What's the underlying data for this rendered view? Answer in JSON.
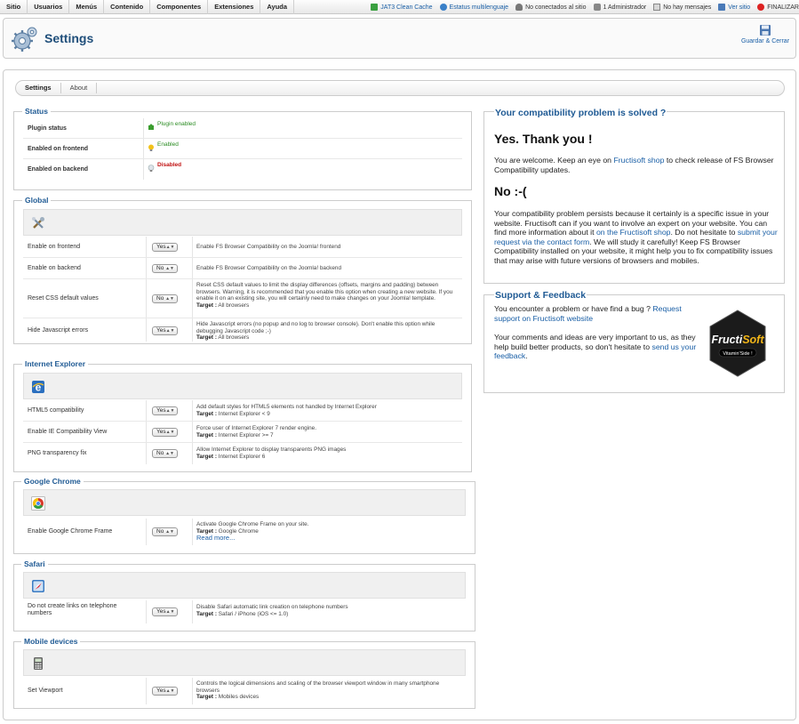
{
  "topbar": {
    "menu": [
      "Sitio",
      "Usuarios",
      "Menús",
      "Contenido",
      "Componentes",
      "Extensiones",
      "Ayuda"
    ],
    "status": [
      {
        "icon": "cache-icon",
        "label": "JAT3 Clean Cache",
        "link": true
      },
      {
        "icon": "globe-icon",
        "label": "Estatus multilenguaje",
        "link": true
      },
      {
        "icon": "user-icon",
        "label": "No conectados al sitio",
        "link": false
      },
      {
        "icon": "users-icon",
        "label": "1 Administrador",
        "link": false
      },
      {
        "icon": "mail-icon",
        "label": "No hay mensajes",
        "link": false
      },
      {
        "icon": "monitor-icon",
        "label": "Ver sitio",
        "link": true
      },
      {
        "icon": "power-icon",
        "label": "FINALIZAR",
        "link": false
      }
    ]
  },
  "toolbar": {
    "title": "Settings",
    "save_label": "Guardar & Cerrar"
  },
  "tabs": [
    "Settings",
    "About"
  ],
  "status_section": {
    "title": "Status",
    "rows": [
      {
        "label": "Plugin status",
        "value": "Plugin enabled"
      },
      {
        "label": "Enabled on frontend",
        "value": "Enabled"
      },
      {
        "label": "Enabled on backend",
        "value": "Disabled"
      }
    ]
  },
  "global_section": {
    "title": "Global",
    "rows": [
      {
        "label": "Enable on frontend",
        "select": "Yes",
        "desc": "Enable FS Browser Compatibility on the Joomla! frontend",
        "target": ""
      },
      {
        "label": "Enable on backend",
        "select": "No",
        "desc": "Enable FS Browser Compatibility on the Joomla! backend",
        "target": ""
      },
      {
        "label": "Reset CSS default values",
        "select": "No",
        "desc": "Reset CSS default values to limit the display differences (offsets, margins and padding) between browsers. Warning, it is recommended that you enable this option when creating a new website. If you enable it on an existing site, you will certainly need to make changes on your Joomla! template.",
        "target": "All browsers"
      },
      {
        "label": "Hide Javascript errors",
        "select": "Yes",
        "desc": "Hide Javascript errors (no popup and no log to browser console). Don't enable this option while debugging Javascript code ;-)",
        "target": "All browsers"
      }
    ]
  },
  "ie_section": {
    "title": "Internet Explorer",
    "rows": [
      {
        "label": "HTML5 compatibility",
        "select": "Yes",
        "desc": "Add default styles for HTML5 elements not handled by Internet Explorer",
        "target": "Internet Explorer < 9"
      },
      {
        "label": "Enable IE Compatibility View",
        "select": "Yes",
        "desc": "Force user of Internet Explorer 7 render engine.",
        "target": "Internet Explorer >= 7"
      },
      {
        "label": "PNG transparency fix",
        "select": "No",
        "desc": "Allow Internet Explorer to display transparents PNG images",
        "target": "Internet Explorer 6"
      }
    ]
  },
  "chrome_section": {
    "title": "Google Chrome",
    "rows": [
      {
        "label": "Enable Google Chrome Frame",
        "select": "No",
        "desc": "Activate Google Chrome Frame on your site.",
        "target": "Google Chrome",
        "link": "Read more..."
      }
    ]
  },
  "safari_section": {
    "title": "Safari",
    "rows": [
      {
        "label": "Do not create links on telephone numbers",
        "select": "Yes",
        "desc": "Disable Safari automatic link creation on telephone numbers",
        "target": "Safari / iPhone (iOS <= 1.0)"
      }
    ]
  },
  "mobile_section": {
    "title": "Mobile devices",
    "rows": [
      {
        "label": "Set Viewport",
        "select": "Yes",
        "desc": "Controls the logical dimensions and scaling of the browser viewport window in many smartphone browsers",
        "target": "Mobiles devices"
      }
    ]
  },
  "target_label": "Target :",
  "compat_panel": {
    "title": "Your compatibility problem is solved ?",
    "yes_heading": "Yes. Thank you !",
    "yes_text_1": "You are welcome. Keep an eye on ",
    "yes_link": "Fructisoft shop",
    "yes_text_2": " to check release of FS Browser Compatibility updates.",
    "no_heading": "No :-(",
    "no_text_1": "Your compatibility problem persists because it certainly is a specific issue in your website. Fructisoft can if you want to involve an expert on your website. You can find more information about it ",
    "no_link_1": "on the Fructisoft shop",
    "no_text_2": ". Do not hesitate to ",
    "no_link_2": "submit your request via the contact form",
    "no_text_3": ". We will study it carefully! Keep FS Browser Compatibility installed on your website, it might help you to fix compatibility issues that may arise with future versions of browsers and mobiles."
  },
  "support_panel": {
    "title": "Support & Feedback",
    "text_1": "You encounter a problem or have find a bug ? ",
    "link_1": "Request support on Fructisoft website",
    "text_2": "Your comments and ideas are very important to us, as they help build better products, so don't hesitate to ",
    "link_2": "send us your feedback",
    "text_3": ".",
    "logo_name": "FructiSoft",
    "logo_name_a": "Fructi",
    "logo_name_b": "Soft",
    "logo_tagline": "Vitamin'Side !"
  },
  "colors": {
    "accent": "#1f5a94",
    "link": "#1a5fa6",
    "enabled": "#2a8b22",
    "disabled": "#c01010"
  }
}
